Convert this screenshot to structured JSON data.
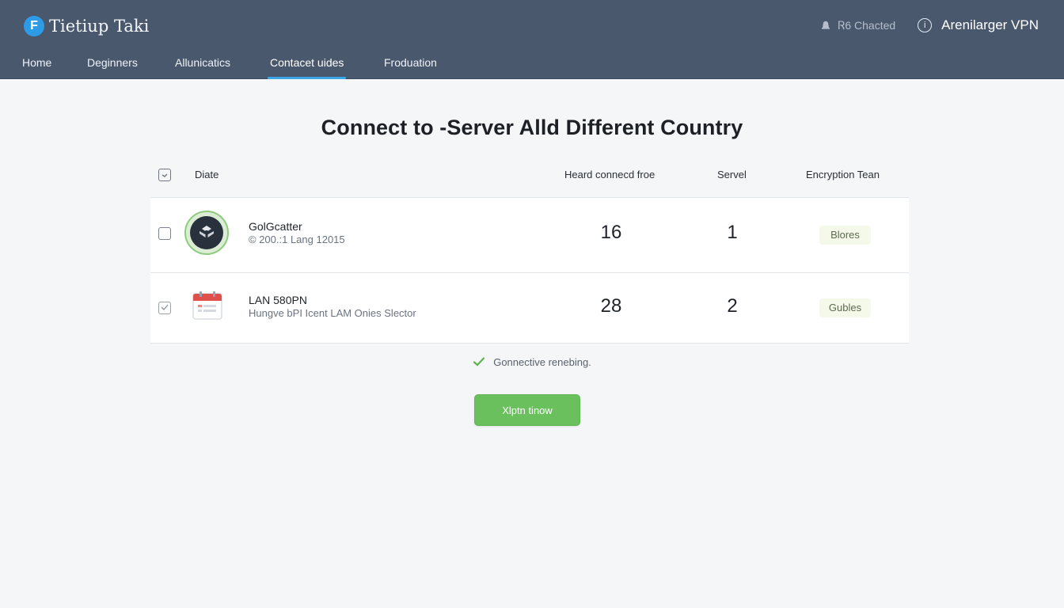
{
  "app": {
    "brand_name": "Tietiup Taki",
    "brand_letter": "F"
  },
  "header": {
    "chat_status": "Ꮢ6 Chacted",
    "vpn_title": "Arenilarger VPN"
  },
  "nav": [
    {
      "label": "Home",
      "active": false
    },
    {
      "label": "Deginners",
      "active": false
    },
    {
      "label": "Allunicatics",
      "active": false
    },
    {
      "label": "Contacet uides",
      "active": true
    },
    {
      "label": "Froduation",
      "active": false
    }
  ],
  "page_title": "Connect to -Server Alld Different Country",
  "table": {
    "columns": [
      "Diate",
      "Heard connecd froe",
      "Servel",
      "Encryption Tean"
    ],
    "rows": [
      {
        "name": "GolGcatter",
        "sub": "© 200.:1 Lang 12015",
        "count": "16",
        "server": "1",
        "encryption": "Blores",
        "icon": "shield-logo-icon",
        "checked": false
      },
      {
        "name": "LAN 580PN",
        "sub": "Hungve bPI Icent LAM Onies Slector",
        "count": "28",
        "server": "2",
        "encryption": "Gubles",
        "icon": "calendar-icon",
        "checked": true
      }
    ]
  },
  "status_text": "Gonnective renebing.",
  "connect_button": "Xlptn tinow",
  "colors": {
    "header_bg": "#4a586e",
    "accent": "#3aa6e8",
    "button_green": "#6ac05d",
    "status_check": "#5cb34d"
  }
}
